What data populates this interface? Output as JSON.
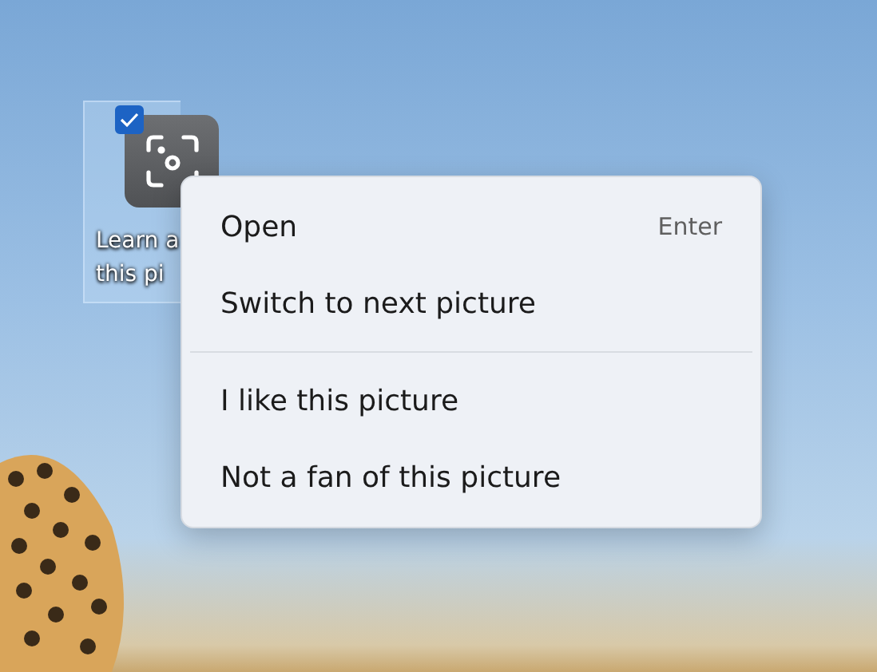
{
  "desktop_icon": {
    "label_lines": [
      "Learn a",
      "this pi"
    ],
    "selected": true,
    "checked": true
  },
  "context_menu": {
    "groups": [
      [
        {
          "label": "Open",
          "shortcut": "Enter"
        },
        {
          "label": "Switch to next picture"
        }
      ],
      [
        {
          "label": "I like this picture"
        },
        {
          "label": "Not a fan of this picture"
        }
      ]
    ]
  }
}
